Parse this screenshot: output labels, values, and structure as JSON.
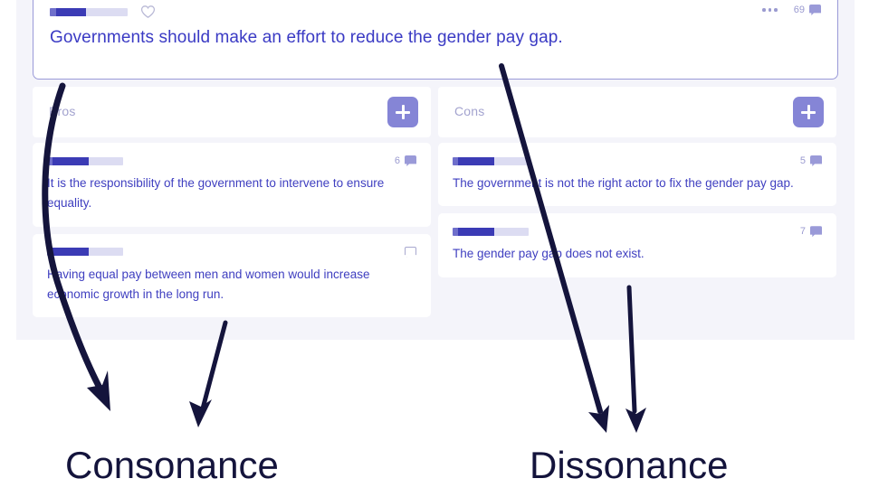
{
  "app": {
    "claim": {
      "text": "Governments should make an effort to reduce the gender pay gap.",
      "author_redacted": true,
      "like_icon": "heart-icon",
      "more_icon": "kebab-menu-icon",
      "comment_count": "69",
      "comment_icon": "comment-flag-icon"
    },
    "columns": [
      {
        "id": "pros",
        "label": "Pros",
        "add_label": "+",
        "add_icon": "plus-icon",
        "cards": [
          {
            "text": "It is the responsibility of the government to intervene to ensure equality.",
            "comment_count": "6",
            "comment_icon": "comment-flag-filled-icon",
            "author_redacted": true
          },
          {
            "text": "Having equal pay between men and women would increase economic growth in the long run.",
            "comment_count": "",
            "comment_icon": "comment-flag-outline-icon",
            "author_redacted": true
          }
        ]
      },
      {
        "id": "cons",
        "label": "Cons",
        "add_label": "+",
        "add_icon": "plus-icon",
        "cards": [
          {
            "text": "The government is not the right actor to fix the gender pay gap.",
            "comment_count": "5",
            "comment_icon": "comment-flag-filled-icon",
            "author_redacted": true
          },
          {
            "text": "The gender pay gap does not exist.",
            "comment_count": "7",
            "comment_icon": "comment-flag-filled-icon",
            "author_redacted": true
          }
        ]
      }
    ]
  },
  "annotations": {
    "consonance_label": "Consonance",
    "dissonance_label": "Dissonance",
    "arrow_color": "#14143c",
    "arrows": [
      {
        "name": "consonance-curved-arrow",
        "from": "pros-column-header",
        "to": "consonance-label"
      },
      {
        "name": "consonance-straight-arrow",
        "from": "pros-second-card",
        "to": "consonance-label"
      },
      {
        "name": "dissonance-long-arrow",
        "from": "claim-card",
        "to": "dissonance-label"
      },
      {
        "name": "dissonance-short-arrow",
        "from": "cons-second-card",
        "to": "dissonance-label"
      }
    ]
  },
  "colors": {
    "page_background": "#f4f4fa",
    "card_background": "#ffffff",
    "claim_text": "#3a3ac4",
    "argument_text": "#3f3fc0",
    "column_label": "#a3a3cf",
    "accent_purple": "#8585d6",
    "redaction_dark": "#3b3bb5",
    "redaction_light": "#dcdcf2",
    "annotation_ink": "#14143c"
  }
}
